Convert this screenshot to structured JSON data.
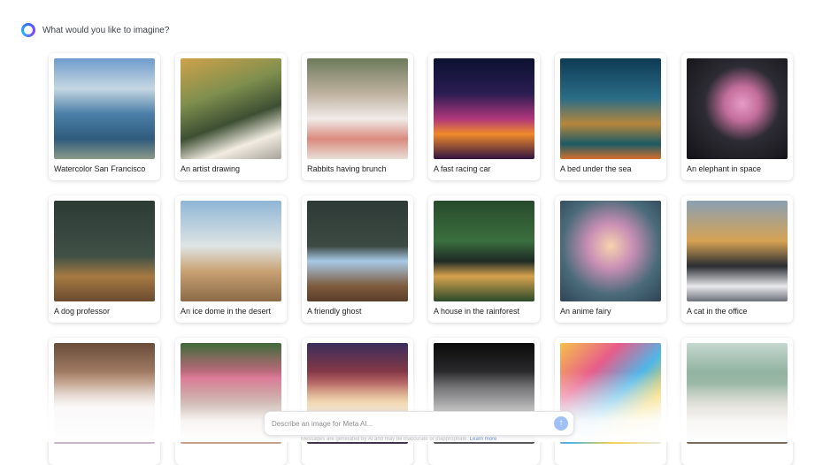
{
  "header": {
    "prompt": "What would you like to imagine?",
    "logo_icon": "meta-ai-ring-icon"
  },
  "cards": [
    {
      "caption": "Watercolor San Francisco"
    },
    {
      "caption": "An artist drawing"
    },
    {
      "caption": "Rabbits having brunch"
    },
    {
      "caption": "A fast racing car"
    },
    {
      "caption": "A bed under the sea"
    },
    {
      "caption": "An elephant in space"
    },
    {
      "caption": "A dog professor"
    },
    {
      "caption": "An ice dome in the desert"
    },
    {
      "caption": "A friendly ghost"
    },
    {
      "caption": "A house in the rainforest"
    },
    {
      "caption": "An anime fairy"
    },
    {
      "caption": "A cat in the office"
    },
    {
      "caption": ""
    },
    {
      "caption": ""
    },
    {
      "caption": ""
    },
    {
      "caption": ""
    },
    {
      "caption": ""
    },
    {
      "caption": ""
    }
  ],
  "input": {
    "placeholder": "Describe an image for Meta AI..."
  },
  "send_icon": "arrow-up-icon",
  "footer": {
    "text": "Messages are generated by AI and may be inaccurate or inappropriate.",
    "link": "Learn more"
  }
}
